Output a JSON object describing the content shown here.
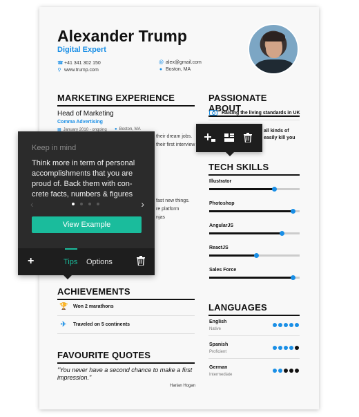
{
  "header": {
    "name": "Alexander Trump",
    "role": "Digital Expert",
    "phone": "+41 341 302 150",
    "website": "www.trump.com",
    "email": "alex@gmail.com",
    "location": "Boston, MA"
  },
  "sections": {
    "experience": "MARKETING EXPERIENCE",
    "passionate": "PASSIONATE ABOUT",
    "tech": "TECH SKILLS",
    "achievements": "ACHIEVEMENTS",
    "languages": "LANGUAGES",
    "quotes": "FAVOURITE QUOTES"
  },
  "experience": {
    "title": "Head of Marketing",
    "company": "Comma Advertising",
    "dates": "January 2010 - ongoing",
    "location": "Boston, MA",
    "peek_1": "their dream jobs.",
    "peek_2": "their first interview",
    "peek_3": "fast new things.",
    "peek_4": "re platform",
    "peek_5": "njas"
  },
  "passion": {
    "item_1": "Raising the living standards in UK",
    "peek_1": "all kinds of",
    "peek_2": "easily kill you"
  },
  "skills": [
    {
      "label": "Illustrator",
      "value": 0.72
    },
    {
      "label": "Photoshop",
      "value": 0.92
    },
    {
      "label": "AngularJS",
      "value": 0.8
    },
    {
      "label": "ReactJS",
      "value": 0.52
    },
    {
      "label": "Sales Force",
      "value": 0.92
    }
  ],
  "achievements": [
    {
      "label": "Won 2 marathons",
      "icon": "trophy-icon"
    },
    {
      "label": "Traveled on 5 continents",
      "icon": "plane-icon"
    }
  ],
  "languages": [
    {
      "name": "English",
      "level": "Native",
      "filled": 5
    },
    {
      "name": "Spanish",
      "level": "Proficient",
      "filled": 4
    },
    {
      "name": "German",
      "level": "Intermediate",
      "filled": 2
    }
  ],
  "quote": {
    "text": "\"You never have a second chance to make a first impression.\"",
    "author": "Harlan Hogan"
  },
  "tips_panel": {
    "heading": "Keep in mind",
    "body": "Think more in term of personal accomplishments that you are proud of. Back them with con-crete facts, numbers & figures",
    "button": "View Example",
    "tab_tips": "Tips",
    "tab_options": "Options"
  },
  "colors": {
    "accent": "#1a8fe6",
    "button": "#1abc9c",
    "panel": "#2b2b2b"
  }
}
